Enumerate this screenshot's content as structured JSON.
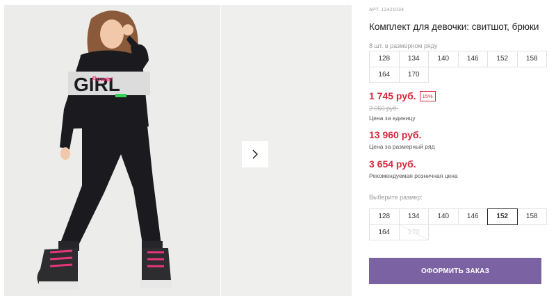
{
  "gallery": {
    "main_photo": "product-photo-girl-in-black-tracksuit",
    "next_icon": "chevron-right-icon"
  },
  "product": {
    "article": "АРТ. 12421034",
    "title": "Комплект для девочки: свитшот, брюки",
    "row_note": "8 шт. в размерном ряду",
    "row_sizes": [
      "128",
      "134",
      "140",
      "146",
      "152",
      "158",
      "164",
      "170"
    ]
  },
  "pricing": {
    "price": "1 745 руб.",
    "discount": "15%",
    "old_price": "2 050 руб.",
    "unit_note": "Цена за единицу",
    "row_price": "13 960 руб.",
    "row_note": "Цена за размерный ряд",
    "rrp": "3 654 руб.",
    "rrp_note": "Рекомендуемая розничная цена",
    "accent_color": "#d6293e"
  },
  "size_picker": {
    "label": "Выберите размер:",
    "sizes": [
      "128",
      "134",
      "140",
      "146",
      "152",
      "158",
      "164",
      "170"
    ],
    "selected": "152",
    "unavailable": [
      "170"
    ]
  },
  "order": {
    "button_label": "ОФОРМИТЬ ЗАКАЗ",
    "button_color": "#7b62a3"
  }
}
